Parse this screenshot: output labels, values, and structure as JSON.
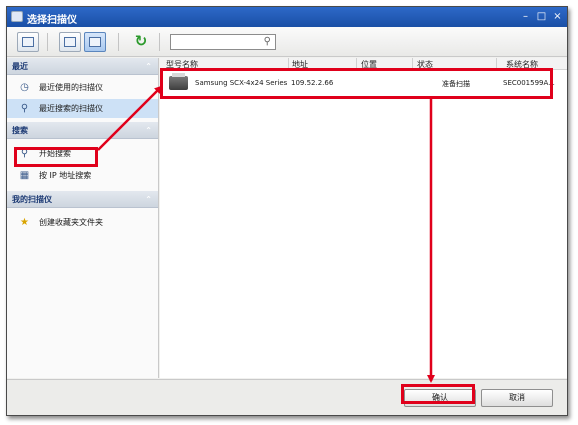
{
  "window": {
    "title": "选择扫描仪",
    "minimize_glyph": "–",
    "maximize_glyph": "□",
    "close_glyph": "×"
  },
  "toolbar": {
    "search": {
      "value": "",
      "placeholder": ""
    },
    "icons": [
      "list-view-icon",
      "details-view-icon",
      "tile-view-icon",
      "refresh-icon",
      "search-icon"
    ]
  },
  "sidebar": {
    "sections": [
      {
        "title": "最近",
        "items": [
          "最近使用的扫描仪",
          "最近搜索的扫描仪"
        ]
      },
      {
        "title": "搜索",
        "items": [
          "开始搜索",
          "按 IP 地址搜索"
        ]
      },
      {
        "title": "我的扫描仪",
        "items": [
          "创建收藏夹文件夹"
        ]
      }
    ],
    "selected_item": "最近搜索的扫描仪"
  },
  "table": {
    "columns": [
      "型号名称",
      "地址",
      "位置",
      "状态",
      "系统名称"
    ],
    "rows": [
      {
        "model": "Samsung SCX-4x24 Series",
        "address": "109.52.2.66",
        "location": "",
        "status": "准备扫描",
        "system_name": "SEC001599A..."
      }
    ]
  },
  "buttons": {
    "ok": "确认",
    "cancel": "取消"
  },
  "colors": {
    "title_bar": "#2d69c8",
    "highlight": "#e0001b",
    "selection": "#cde1f6"
  }
}
